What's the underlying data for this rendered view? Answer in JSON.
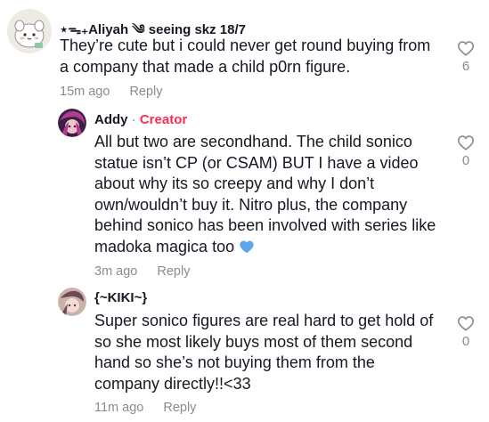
{
  "comments": [
    {
      "username": "⋆ᯓ₊Aliyah ༄ seeing skz 18/7",
      "text": "They’re cute but i could never get round buying from a company that made a child p0rn figure.",
      "time": "15m ago",
      "reply_label": "Reply",
      "likes": "6",
      "is_creator": false
    },
    {
      "username": "Addy",
      "creator_separator": "·",
      "creator_label": "Creator",
      "text": "All but two are secondhand. The child sonico statue isn’t CP (or CSAM) BUT I have a video about why its so creepy and why I don’t own/wouldn’t buy it. Nitro plus, the company behind sonico has been involved with series like madoka magica too",
      "emoji": "blue-heart",
      "time": "3m ago",
      "reply_label": "Reply",
      "likes": "0",
      "is_creator": true
    },
    {
      "username": "{~KIKI~}",
      "text": "Super sonico figures are real hard to get hold of so she most likely buys most of them second hand so she’s not buying them from the company directly!!<33",
      "time": "11m ago",
      "reply_label": "Reply",
      "likes": "0",
      "is_creator": false
    }
  ],
  "colors": {
    "text": "#161823",
    "muted": "#8a8b91",
    "creator": "#fe2c55",
    "heart_emoji": "#5aa6e8"
  }
}
